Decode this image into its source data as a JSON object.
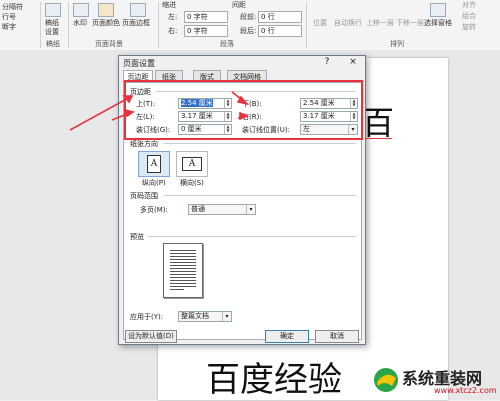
{
  "ribbon": {
    "left_items": [
      "分隔符",
      "行号",
      "断字"
    ],
    "draft_label": "稿纸",
    "draft_label2": "设置",
    "draft_group": "稿纸",
    "watermark_label": "水印",
    "page_color_label": "页面颜色",
    "page_border_label": "页面边框",
    "page_bg_group": "页面背景",
    "indent_header": "缩进",
    "spacing_header": "间距",
    "indent_left_label": "左:",
    "indent_left_value": "0 字符",
    "indent_right_label": "右:",
    "indent_right_value": "0 字符",
    "spacing_before_label": "段前:",
    "spacing_before_value": "0 行",
    "spacing_after_label": "段后:",
    "spacing_after_value": "0 行",
    "paragraph_group": "段落",
    "position_label": "位置",
    "wrap_label": "自动换行",
    "forward_label": "上移一层",
    "backward_label": "下移一层",
    "select_pane_label": "选择窗格",
    "arrange_group": "排列",
    "align_label": "对齐",
    "group_label": "组合",
    "rotate_label": "旋转"
  },
  "doc": {
    "partial_char": "百",
    "heading": "百度经验"
  },
  "dialog": {
    "title": "页面设置",
    "help": "?",
    "close": "×",
    "tabs": [
      "页边距",
      "纸张",
      "版式",
      "文档网格"
    ],
    "margins_section": "页边距",
    "top_label": "上(T):",
    "top_value": "2.54 厘米",
    "bottom_label": "下(B):",
    "bottom_value": "2.54 厘米",
    "left_label": "左(L):",
    "left_value": "3.17 厘米",
    "right_label": "右(R):",
    "right_value": "3.17 厘米",
    "gutter_label": "装订线(G):",
    "gutter_value": "0 厘米",
    "gutter_pos_label": "装订线位置(U):",
    "gutter_pos_value": "左",
    "orientation_section": "纸张方向",
    "portrait_label": "纵向(P)",
    "landscape_label": "横向(S)",
    "pages_section": "页码范围",
    "multi_pages_label": "多页(M):",
    "multi_pages_value": "普通",
    "preview_section": "预览",
    "apply_label": "应用于(Y):",
    "apply_value": "整篇文档",
    "default_button": "设为默认值(D)",
    "ok_button": "确定",
    "cancel_button": "取消"
  },
  "watermark": {
    "brand": "系统重装网",
    "url": "www.xtcz2.com"
  },
  "colors": {
    "annotation_red": "#e8333f",
    "selection_blue": "#3370cc"
  }
}
